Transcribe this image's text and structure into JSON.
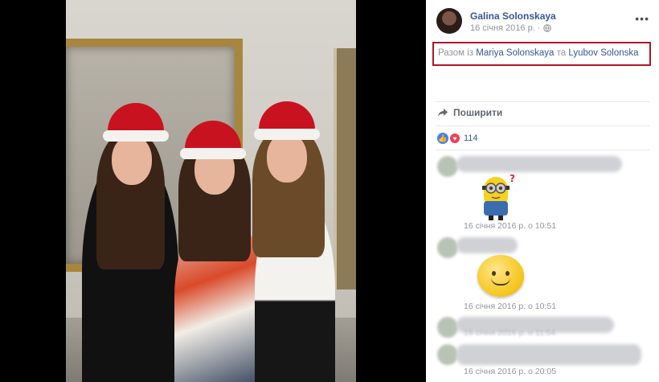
{
  "post": {
    "author": "Galina Solonskaya",
    "date": "16 січня 2016 р. ·",
    "more_label": "•••",
    "tag_prefix": "Разом із",
    "tag_person1": "Mariya Solonskaya",
    "tag_joiner": "та",
    "tag_person2": "Lyubov Solonska",
    "share_label": "Поширити",
    "reaction_count": "114"
  },
  "comments": [
    {
      "time": "16 січня 2016 р. о 10:51",
      "sticker": "minion-sticker"
    },
    {
      "time": "16 січня 2016 р. о 10:51",
      "sticker": "smiley-sticker"
    },
    {
      "time": "16 січня 2016 р. о 11:54"
    },
    {
      "time": "16 січня 2016 р. о 20:05"
    }
  ],
  "colors": {
    "link": "#365899",
    "highlight_border": "#b0132a",
    "hat": "#c8121f"
  }
}
